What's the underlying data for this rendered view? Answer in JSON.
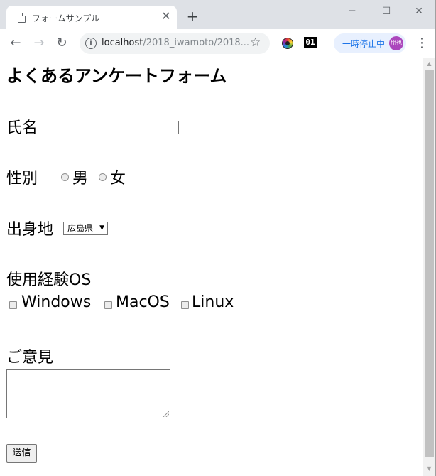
{
  "browser": {
    "tab_title": "フォームサンプル",
    "tab_close": "✕",
    "new_tab": "+",
    "url_host": "localhost",
    "url_path": "/2018_iwamoto/2018...",
    "paused_label": "一時停止中",
    "avatar_text": "朋也",
    "ext_label": "01"
  },
  "form": {
    "title": "よくあるアンケートフォーム",
    "name_label": "氏名",
    "name_value": "",
    "gender_label": "性別",
    "gender_options": [
      "男",
      "女"
    ],
    "origin_label": "出身地",
    "origin_selected": "広島県",
    "os_label": "使用経験OS",
    "os_options": [
      "Windows",
      "MacOS",
      "Linux"
    ],
    "opinion_label": "ご意見",
    "opinion_value": "",
    "submit_label": "送信"
  }
}
